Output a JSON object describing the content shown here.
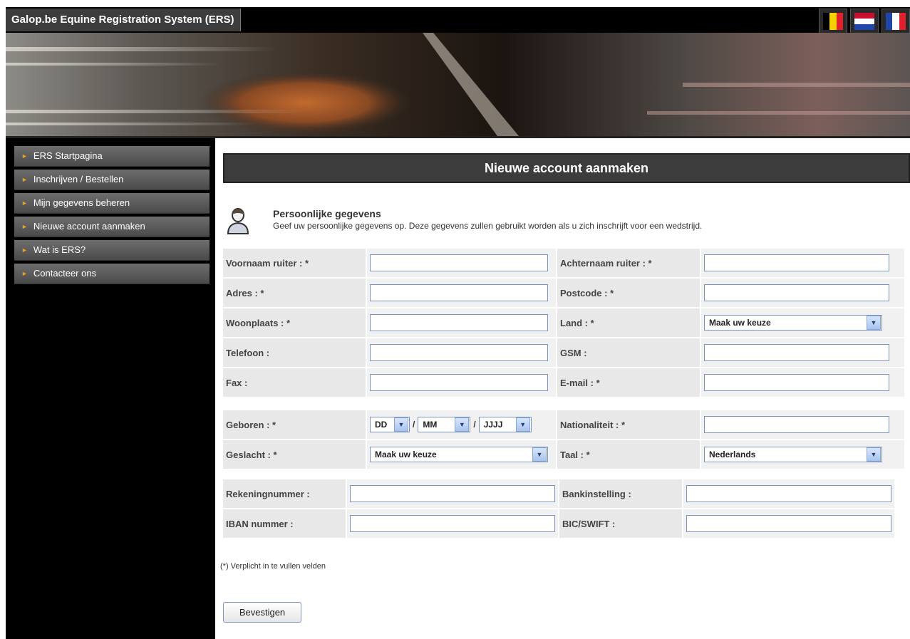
{
  "app": {
    "title": "Galop.be Equine Registration System (ERS)"
  },
  "flags": [
    {
      "name": "belgium-flag-icon",
      "colors": [
        "#000000",
        "#f7d000",
        "#e0202a"
      ]
    },
    {
      "name": "netherlands-flag-icon",
      "colors": [
        "#c8102e",
        "#ffffff",
        "#1f46a8"
      ]
    },
    {
      "name": "france-flag-icon",
      "colors": [
        "#1f46a8",
        "#ffffff",
        "#e0202a"
      ]
    }
  ],
  "nav": {
    "items": [
      {
        "label": "ERS Startpagina"
      },
      {
        "label": "Inschrijven / Bestellen"
      },
      {
        "label": "Mijn gegevens beheren"
      },
      {
        "label": "Nieuwe account aanmaken"
      },
      {
        "label": "Wat is ERS?"
      },
      {
        "label": "Contacteer ons"
      }
    ]
  },
  "page": {
    "heading": "Nieuwe account aanmaken",
    "section_title": "Persoonlijke gegevens",
    "section_desc": "Geef uw persoonlijke gegevens op. Deze gegevens zullen gebruikt worden als u zich inschrijft voor een wedstrijd."
  },
  "form": {
    "voornaam": {
      "label": "Voornaam ruiter : *",
      "value": ""
    },
    "achternaam": {
      "label": "Achternaam ruiter : *",
      "value": ""
    },
    "adres": {
      "label": "Adres : *",
      "value": ""
    },
    "postcode": {
      "label": "Postcode : *",
      "value": ""
    },
    "woonplaats": {
      "label": "Woonplaats : *",
      "value": ""
    },
    "land": {
      "label": "Land : *",
      "value": "Maak uw keuze"
    },
    "telefoon": {
      "label": "Telefoon :",
      "value": ""
    },
    "gsm": {
      "label": "GSM :",
      "value": ""
    },
    "fax": {
      "label": "Fax :",
      "value": ""
    },
    "email": {
      "label": "E-mail : *",
      "value": ""
    },
    "geboren": {
      "label": "Geboren : *",
      "day": "DD",
      "month": "MM",
      "year": "JJJJ",
      "separator": "/"
    },
    "nationaliteit": {
      "label": "Nationaliteit : *",
      "value": ""
    },
    "geslacht": {
      "label": "Geslacht : *",
      "value": "Maak uw keuze"
    },
    "taal": {
      "label": "Taal : *",
      "value": "Nederlands"
    },
    "rekeningnummer": {
      "label": "Rekeningnummer :",
      "value": ""
    },
    "bankinstelling": {
      "label": "Bankinstelling :",
      "value": ""
    },
    "iban": {
      "label": "IBAN nummer :",
      "value": ""
    },
    "bic": {
      "label": "BIC/SWIFT :",
      "value": ""
    }
  },
  "note": "(*) Verplicht in te vullen velden",
  "submit_label": "Bevestigen"
}
